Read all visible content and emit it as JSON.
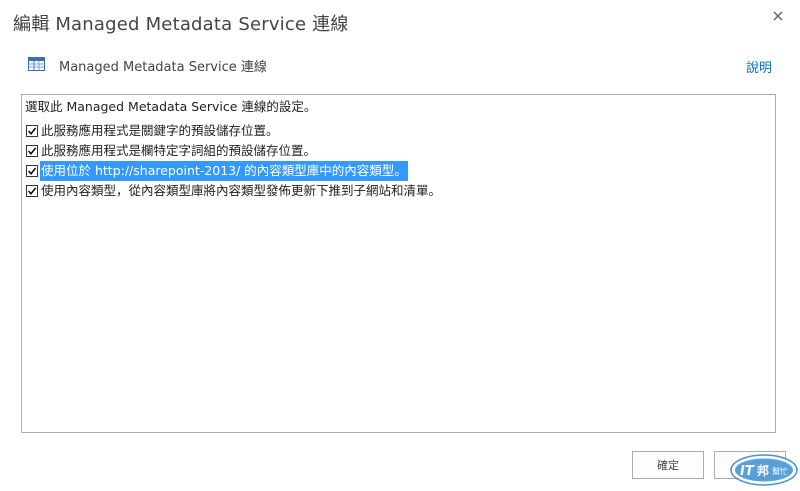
{
  "dialog": {
    "title": "編輯 Managed Metadata Service 連線",
    "close_icon": "close-icon"
  },
  "subheader": {
    "icon": "table-icon",
    "label": "Managed Metadata Service 連線",
    "help_label": "說明"
  },
  "settings": {
    "intro": "選取此 Managed Metadata Service 連線的設定。",
    "options": [
      {
        "label": "此服務應用程式是關鍵字的預設儲存位置。",
        "checked": true,
        "selected": false
      },
      {
        "label": "此服務應用程式是欄特定字詞組的預設儲存位置。",
        "checked": true,
        "selected": false
      },
      {
        "label": "使用位於 http://sharepoint-2013/ 的內容類型庫中的內容類型。",
        "checked": true,
        "selected": true
      },
      {
        "label": "使用內容類型，從內容類型庫將內容類型發佈更新下推到子網站和清單。",
        "checked": true,
        "selected": false
      }
    ]
  },
  "buttons": {
    "ok_label": "確定",
    "cancel_label": ""
  },
  "watermark": {
    "text": "IT邦 幫忙",
    "icon": "ithome-logo"
  },
  "colors": {
    "link": "#0072c6",
    "selection": "#3399ff",
    "border": "#ababab",
    "text": "#444444"
  }
}
